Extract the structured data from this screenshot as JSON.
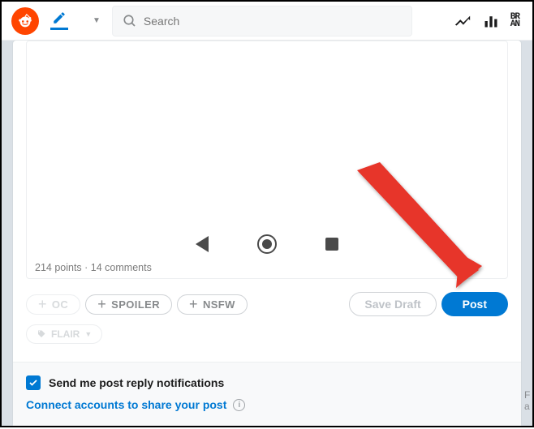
{
  "header": {
    "search_placeholder": "Search"
  },
  "preview": {
    "meta_text": "214 points · 14 comments"
  },
  "tags": {
    "oc": "OC",
    "spoiler": "SPOILER",
    "nsfw": "NSFW",
    "flair": "FLAIR"
  },
  "actions": {
    "save_draft": "Save Draft",
    "post": "Post"
  },
  "footer": {
    "notify_label": "Send me post reply notifications",
    "connect_label": "Connect accounts to share your post"
  }
}
